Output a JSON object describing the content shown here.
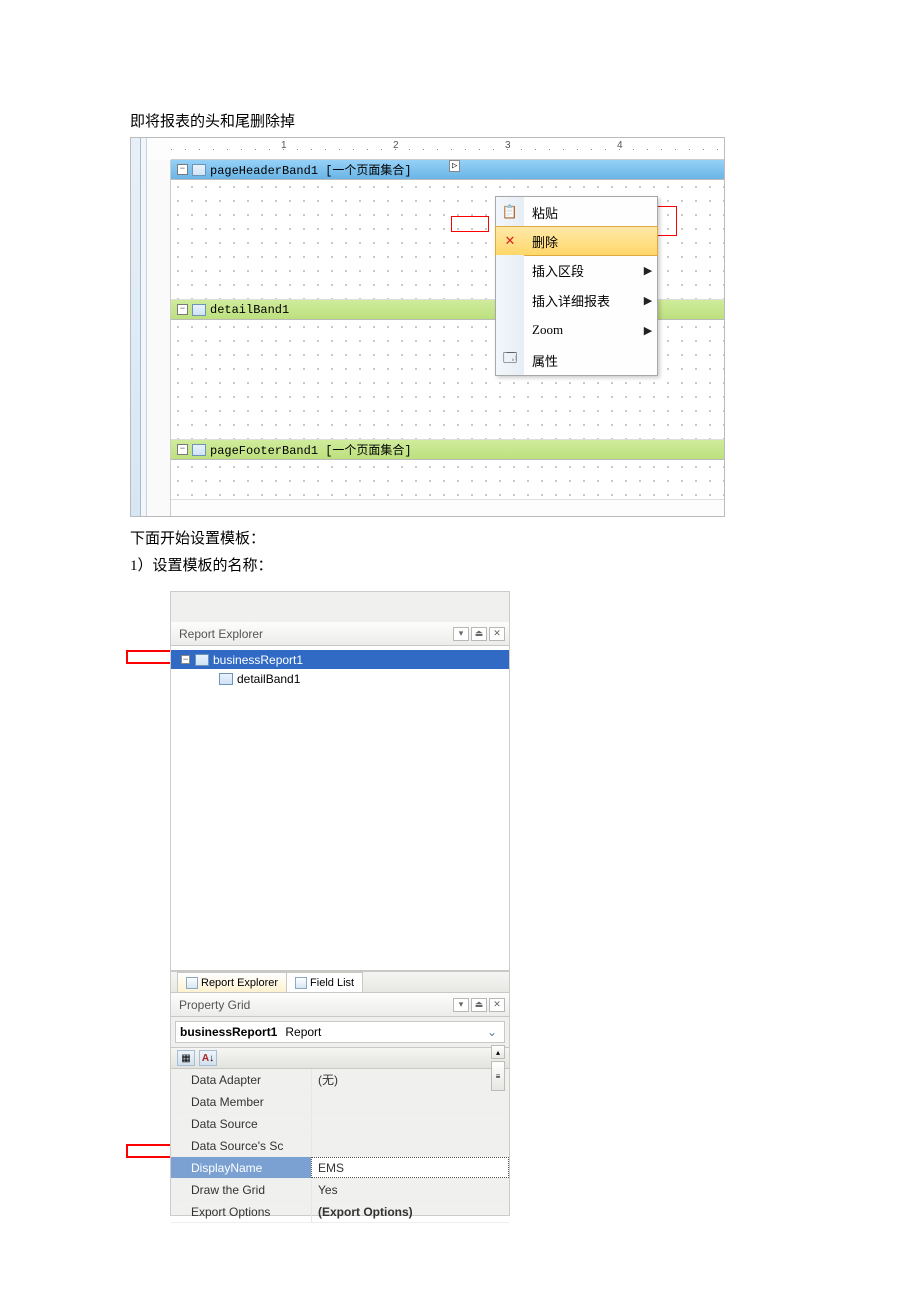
{
  "doc": {
    "line1": "即将报表的头和尾删除掉",
    "line2": "下面开始设置模板：",
    "line3": "1）设置模板的名称："
  },
  "ruler": {
    "n1": "1",
    "n2": "2",
    "n3": "3",
    "n4": "4"
  },
  "bands": {
    "pageHeader": "pageHeaderBand1 [一个页面集合]",
    "detail": "detailBand1",
    "pageFooter": "pageFooterBand1 [一个页面集合]",
    "tag": "▷"
  },
  "ctx": {
    "paste": "粘贴",
    "delete": "删除",
    "insertSection": "插入区段",
    "insertDetail": "插入详细报表",
    "zoom": "Zoom",
    "props": "属性"
  },
  "explorer": {
    "title": "Report Explorer",
    "root": "businessReport1",
    "child": "detailBand1",
    "tab1": "Report Explorer",
    "tab2": "Field List"
  },
  "propgrid": {
    "title": "Property Grid",
    "combo_name": "businessReport1",
    "combo_type": "Report",
    "rows": {
      "dataAdapter": {
        "n": "Data Adapter",
        "v": "(无)"
      },
      "dataMember": {
        "n": "Data Member",
        "v": ""
      },
      "dataSource": {
        "n": "Data Source",
        "v": ""
      },
      "dataSourceSc": {
        "n": "Data Source's Sc",
        "v": ""
      },
      "displayName": {
        "n": "DisplayName",
        "v": "EMS"
      },
      "drawGrid": {
        "n": "Draw the Grid",
        "v": "Yes"
      },
      "exportOpt": {
        "n": "Export Options",
        "v": "(Export Options)"
      }
    }
  }
}
